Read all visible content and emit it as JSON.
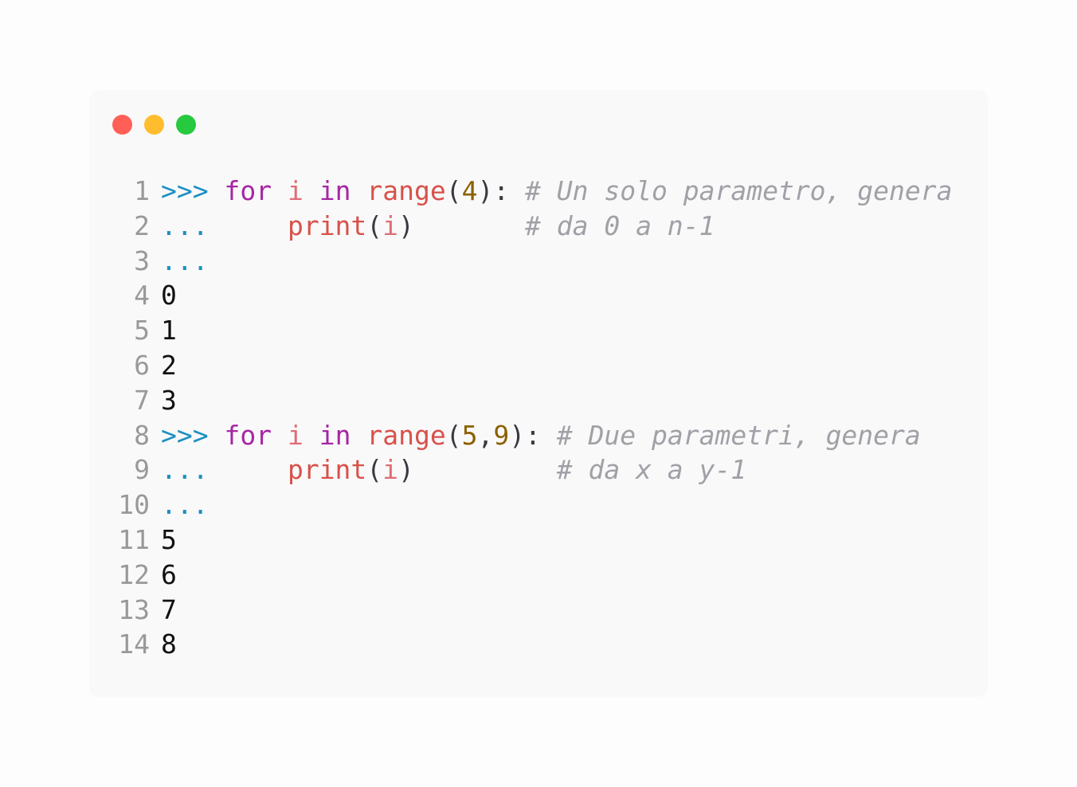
{
  "window": {
    "controls": [
      {
        "name": "close-button",
        "color": "#ff5f56"
      },
      {
        "name": "minimize-button",
        "color": "#ffbd2e"
      },
      {
        "name": "maximize-button",
        "color": "#27c93f"
      }
    ]
  },
  "code": {
    "lines": [
      {
        "number": "1",
        "tokens": [
          {
            "text": ">>>",
            "kind": "prompt"
          },
          {
            "text": " ",
            "kind": "space"
          },
          {
            "text": "for",
            "kind": "keyword"
          },
          {
            "text": " ",
            "kind": "space"
          },
          {
            "text": "i",
            "kind": "var"
          },
          {
            "text": " ",
            "kind": "space"
          },
          {
            "text": "in",
            "kind": "keyword"
          },
          {
            "text": " ",
            "kind": "space"
          },
          {
            "text": "range",
            "kind": "builtin"
          },
          {
            "text": "(",
            "kind": "punct"
          },
          {
            "text": "4",
            "kind": "num"
          },
          {
            "text": "):",
            "kind": "punct"
          },
          {
            "text": " ",
            "kind": "space"
          },
          {
            "text": "# Un solo parametro, genera",
            "kind": "comment"
          }
        ]
      },
      {
        "number": "2",
        "tokens": [
          {
            "text": "...",
            "kind": "prompt"
          },
          {
            "text": "     ",
            "kind": "space"
          },
          {
            "text": "print",
            "kind": "builtin"
          },
          {
            "text": "(",
            "kind": "punct"
          },
          {
            "text": "i",
            "kind": "var"
          },
          {
            "text": ")",
            "kind": "punct"
          },
          {
            "text": "       ",
            "kind": "space"
          },
          {
            "text": "# da 0 a n-1",
            "kind": "comment"
          }
        ]
      },
      {
        "number": "3",
        "tokens": [
          {
            "text": "...",
            "kind": "prompt"
          }
        ]
      },
      {
        "number": "4",
        "tokens": [
          {
            "text": "0",
            "kind": "output"
          }
        ]
      },
      {
        "number": "5",
        "tokens": [
          {
            "text": "1",
            "kind": "output"
          }
        ]
      },
      {
        "number": "6",
        "tokens": [
          {
            "text": "2",
            "kind": "output"
          }
        ]
      },
      {
        "number": "7",
        "tokens": [
          {
            "text": "3",
            "kind": "output"
          }
        ]
      },
      {
        "number": "8",
        "tokens": [
          {
            "text": ">>>",
            "kind": "prompt"
          },
          {
            "text": " ",
            "kind": "space"
          },
          {
            "text": "for",
            "kind": "keyword"
          },
          {
            "text": " ",
            "kind": "space"
          },
          {
            "text": "i",
            "kind": "var"
          },
          {
            "text": " ",
            "kind": "space"
          },
          {
            "text": "in",
            "kind": "keyword"
          },
          {
            "text": " ",
            "kind": "space"
          },
          {
            "text": "range",
            "kind": "builtin"
          },
          {
            "text": "(",
            "kind": "punct"
          },
          {
            "text": "5",
            "kind": "num"
          },
          {
            "text": ",",
            "kind": "punct"
          },
          {
            "text": "9",
            "kind": "num"
          },
          {
            "text": "):",
            "kind": "punct"
          },
          {
            "text": " ",
            "kind": "space"
          },
          {
            "text": "# Due parametri, genera",
            "kind": "comment"
          }
        ]
      },
      {
        "number": "9",
        "tokens": [
          {
            "text": "...",
            "kind": "prompt"
          },
          {
            "text": "     ",
            "kind": "space"
          },
          {
            "text": "print",
            "kind": "builtin"
          },
          {
            "text": "(",
            "kind": "punct"
          },
          {
            "text": "i",
            "kind": "var"
          },
          {
            "text": ")",
            "kind": "punct"
          },
          {
            "text": "         ",
            "kind": "space"
          },
          {
            "text": "# da x a y-1",
            "kind": "comment"
          }
        ]
      },
      {
        "number": "10",
        "tokens": [
          {
            "text": "...",
            "kind": "prompt"
          }
        ]
      },
      {
        "number": "11",
        "tokens": [
          {
            "text": "5",
            "kind": "output"
          }
        ]
      },
      {
        "number": "12",
        "tokens": [
          {
            "text": "6",
            "kind": "output"
          }
        ]
      },
      {
        "number": "13",
        "tokens": [
          {
            "text": "7",
            "kind": "output"
          }
        ]
      },
      {
        "number": "14",
        "tokens": [
          {
            "text": "8",
            "kind": "output"
          }
        ]
      }
    ]
  }
}
